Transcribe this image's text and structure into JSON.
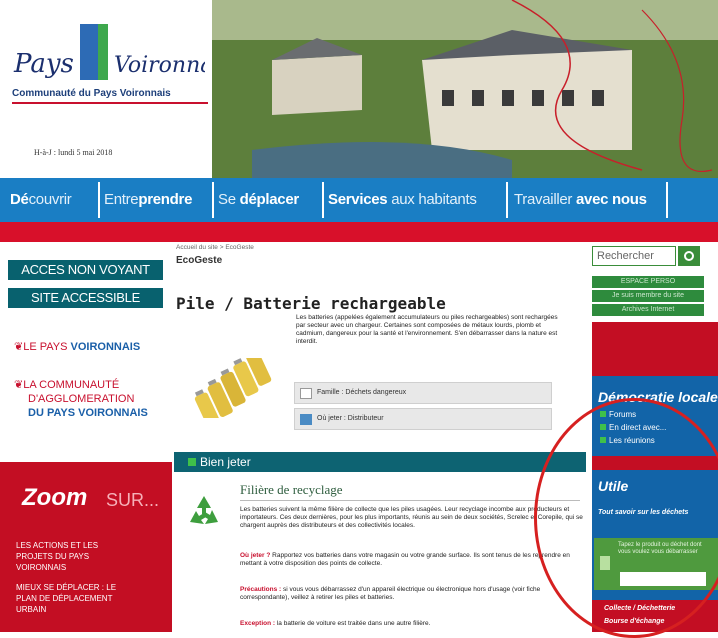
{
  "header": {
    "brand_line1": "Pays",
    "brand_line2": "Voironnais",
    "brand_sub": "Communauté du Pays Voironnais",
    "date": "H-à-J : lundi 5 mai 2018"
  },
  "nav": {
    "items": [
      {
        "pre": "Dé",
        "bold_pre": true,
        "rest": "couvrir"
      },
      {
        "pre": "Entre",
        "bold": "prendre"
      },
      {
        "pre": "Se ",
        "bold": "déplacer"
      },
      {
        "pre": "",
        "bold": "Services",
        "rest": " aux habitants"
      },
      {
        "pre": "Travailler ",
        "bold": "avec nous"
      }
    ]
  },
  "left": {
    "accessibility_buttons": [
      "ACCES NON VOYANT",
      "SITE ACCESSIBLE"
    ],
    "logo1_pre": "LE PAYS ",
    "logo1_bold": "VOIRONNAIS",
    "logo2_line1": "LA COMMUNAUTÉ",
    "logo2_line2": "D'AGGLOMERATION",
    "logo2_line3": "DU PAYS VOIRONNAIS",
    "zoom_title": "Zoom",
    "zoom_sur": "SUR...",
    "zoom_links": [
      "LES ACTIONS ET LES PROJETS DU PAYS VOIRONNAIS",
      "MIEUX SE DÉPLACER : LE PLAN DE DÉPLACEMENT URBAIN"
    ]
  },
  "main": {
    "breadcrumb": "Accueil du site > EcoGeste",
    "section": "EcoGeste",
    "title": "Pile / Batterie rechargeable",
    "intro": "Les batteries (appelées également accumulateurs ou piles rechargeables) sont rechargées par secteur avec un chargeur. Certaines sont composées de métaux lourds, plomb et cadmium, dangereux pour la santé et l'environnement. S'en débarrasser dans la nature est interdit.",
    "famille": "Famille : Déchets dangereux",
    "ou_jeter": "Où jeter : Distributeur",
    "bien_jeter": "Bien jeter",
    "filiere_title": "Filière de recyclage",
    "para1": "Les batteries suivent la même filière de collecte que les piles usagées. Leur recyclage incombe aux producteurs et importateurs. Ces deux dernières, pour les plus importants, réunis au sein de deux sociétés, Screlec et Corepile, qui se chargent auprès des distributeurs et des collectivités locales.",
    "para2_label": "Où jeter ?",
    "para2": " Rapportez vos batteries dans votre magasin ou votre grande surface. Ils sont tenus de les reprendre en mettant à votre disposition des points de collecte.",
    "para3_label": "Précautions :",
    "para3": " si vous vous débarrassez d'un appareil électrique ou électronique hors d'usage (voir fiche correspondante), veillez à retirer les piles et batteries.",
    "para4_label": "Exception :",
    "para4": " la batterie de voiture est traitée dans une autre filière."
  },
  "right": {
    "search_placeholder": "Rechercher",
    "links": [
      "ESPACE PERSO",
      "Je suis membre du site",
      "Archives Internet"
    ],
    "demo_title": "Démocratie locale",
    "demo_items": [
      "Forums",
      "En direct avec...",
      "Les réunions"
    ],
    "utile_title": "Utile",
    "utile_sub": "Tout savoir sur les déchets",
    "utile_green": "Tapez le produit ou déchet dont vous voulez vous débarrasser",
    "utile_links": [
      "Collecte / Déchetterie",
      "Bourse d'échange"
    ]
  }
}
